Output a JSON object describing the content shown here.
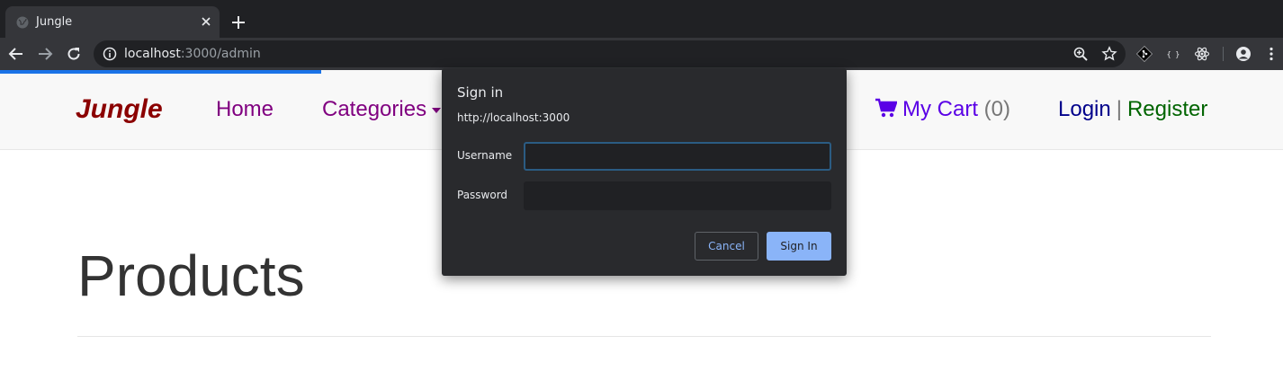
{
  "browser": {
    "tab": {
      "title": "Jungle"
    },
    "address": {
      "host": "localhost",
      "path": ":3000/admin"
    }
  },
  "site": {
    "brand": "Jungle",
    "nav": {
      "home": "Home",
      "categories": "Categories"
    },
    "cart": {
      "label": "My Cart",
      "count": "(0)"
    },
    "auth": {
      "login": "Login",
      "separator": "|",
      "register": "Register"
    }
  },
  "page": {
    "title": "Products"
  },
  "dialog": {
    "title": "Sign in",
    "origin": "http://localhost:3000",
    "username_label": "Username",
    "password_label": "Password",
    "username_value": "",
    "password_value": "",
    "cancel_label": "Cancel",
    "signin_label": "Sign In"
  },
  "colors": {
    "brand": "#8b0000",
    "nav_link": "#800080",
    "cart": "#5a00e6",
    "login": "#00008b",
    "register": "#006400",
    "dialog_bg": "#292a2d",
    "primary_button": "#8ab4f8",
    "load_bar": "#1a73e8"
  },
  "icons": {
    "tab": [
      "globe-icon",
      "close-icon",
      "plus-icon"
    ],
    "toolbar": [
      "back-arrow-icon",
      "forward-arrow-icon",
      "reload-icon",
      "info-icon",
      "zoom-icon",
      "star-icon",
      "git-extension-icon",
      "json-extension-icon",
      "react-extension-icon",
      "profile-icon",
      "menu-dots-icon"
    ],
    "page": [
      "shopping-cart-icon",
      "caret-down-icon"
    ]
  }
}
